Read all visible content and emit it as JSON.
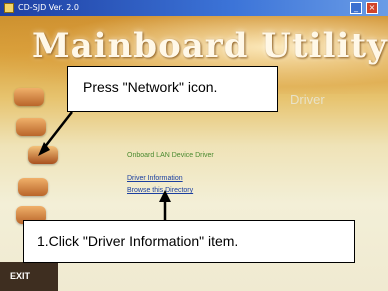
{
  "titlebar": {
    "title": "CD-SJD Ver. 2.0"
  },
  "banner": {
    "title": "Mainboard Utility CD"
  },
  "section": {
    "label": "Driver"
  },
  "content": {
    "onboard": "Onboard LAN Device Driver",
    "driver_info": "Driver Information",
    "browse": "Browse this Directory"
  },
  "sidebar": {
    "exit_label": "EXIT"
  },
  "callouts": {
    "network": "Press \"Network\" icon.",
    "driver": "1.Click \"Driver Information\" item."
  },
  "colors": {
    "title_bar": "#3c74d8",
    "link": "#1b3fa0",
    "onboard_text": "#4a8a30"
  }
}
